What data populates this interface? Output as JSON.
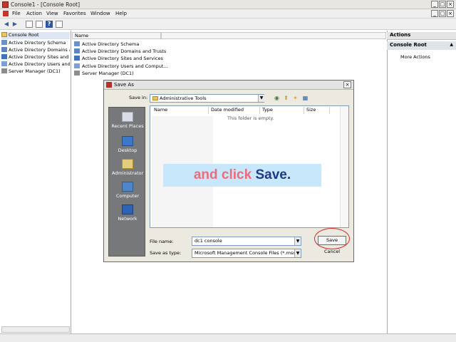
{
  "window": {
    "title": "Console1 - [Console Root]",
    "controls": [
      "_",
      "□",
      "×"
    ]
  },
  "menubar": {
    "items": [
      "File",
      "Action",
      "View",
      "Favorites",
      "Window",
      "Help"
    ]
  },
  "toolbar": {
    "icons": [
      "back-icon",
      "forward-icon",
      "show-hide-tree-icon",
      "properties-icon",
      "help-icon",
      "show-action-pane-icon"
    ]
  },
  "tree": {
    "root": "Console Root",
    "items": [
      "Active Directory Schema",
      "Active Directory Domains and Trusts",
      "Active Directory Sites and Services",
      "Active Directory Users and Computers",
      "Server Manager (DC1)"
    ]
  },
  "center": {
    "column_name": "Name",
    "items": [
      "Active Directory Schema",
      "Active Directory Domains and Trusts",
      "Active Directory Sites and Services",
      "Active Directory Users and Comput...",
      "Server Manager (DC1)"
    ]
  },
  "actions": {
    "title": "Actions",
    "section": "Console Root",
    "more": "More Actions"
  },
  "dialog": {
    "title": "Save As",
    "save_in_label": "Save in:",
    "save_in_value": "Administrative Tools",
    "places": [
      "Recent Places",
      "Desktop",
      "Administrator",
      "Computer",
      "Network"
    ],
    "columns": [
      "Name",
      "Date modified",
      "Type",
      "Size"
    ],
    "empty_message": "This folder is empty.",
    "filename_label": "File name:",
    "filename_value": "dc1 console",
    "savetype_label": "Save as type:",
    "savetype_value": "Microsoft Management Console Files (*.msc)",
    "save_button": "Save",
    "cancel_button": "Cancel"
  },
  "instruction": {
    "part1": "and click ",
    "part2": "Save."
  },
  "colors": {
    "overlay_bg": "#c9e7fb",
    "overlay_text_pink": "#f06b7a",
    "overlay_text_blue": "#1e3a8a",
    "highlight_circle": "#d52b2b"
  }
}
